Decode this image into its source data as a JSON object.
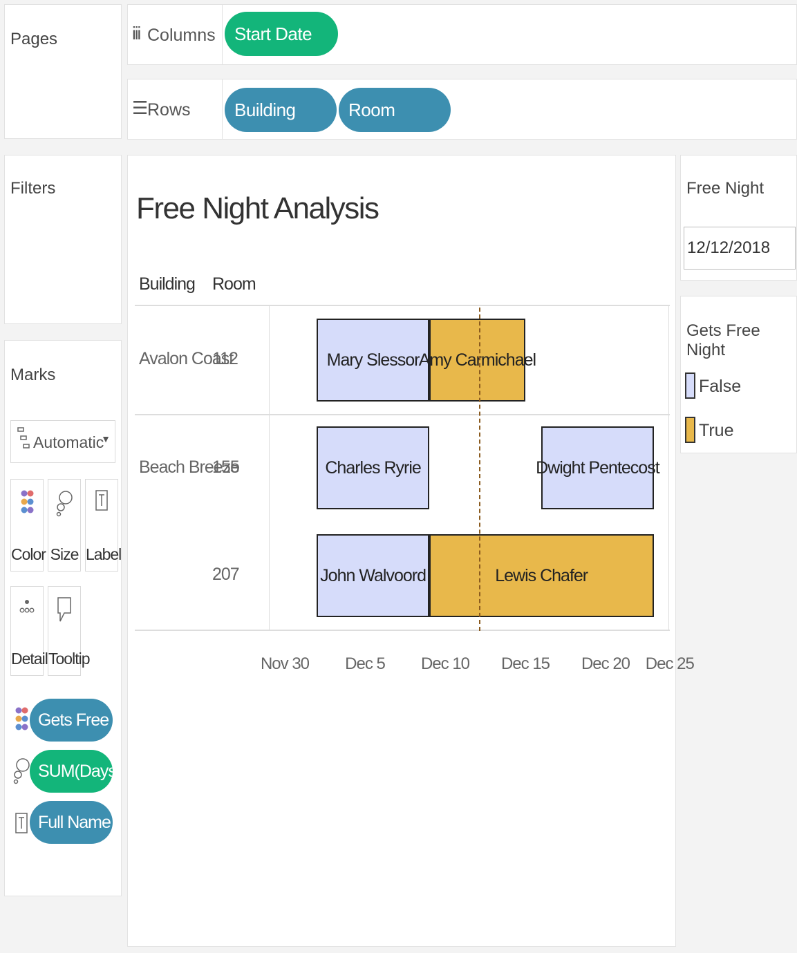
{
  "pages_shelf": {
    "title": "Pages"
  },
  "columns_shelf": {
    "icon": "iii",
    "label": "Columns",
    "pills": [
      "Start Date"
    ]
  },
  "rows_shelf": {
    "icon": "☰",
    "label": "Rows",
    "pills": [
      "Building",
      "Room"
    ]
  },
  "filters_shelf": {
    "title": "Filters"
  },
  "marks": {
    "title": "Marks",
    "mark_type": "Automatic",
    "buttons": {
      "color": "Color",
      "size": "Size",
      "label": "Label",
      "detail": "Detail",
      "tooltip": "Tooltip"
    },
    "fields": [
      {
        "label": "Gets Free Night",
        "role": "color",
        "color": "#3d8fb0"
      },
      {
        "label": "SUM(Days Re..",
        "role": "size",
        "color": "#13b57a"
      },
      {
        "label": "Full Name",
        "role": "label",
        "color": "#3d8fb0"
      }
    ]
  },
  "view": {
    "title": "Free Night Analysis",
    "headers": {
      "building": "Building",
      "room": "Room"
    }
  },
  "colors": {
    "false": "#d6dcfa",
    "true": "#e8b84b",
    "reference_line": "#8a5a1e"
  },
  "chart_data": {
    "type": "gantt",
    "title": "Free Night Analysis",
    "x_field": "Start Date",
    "row_fields": [
      "Building",
      "Room"
    ],
    "color_field": "Gets Free Night",
    "size_field": "SUM(Days Re..",
    "label_field": "Full Name",
    "x_ticks": [
      "Nov 30",
      "Dec 5",
      "Dec 10",
      "Dec 15",
      "Dec 20",
      "Dec 25"
    ],
    "reference_line": "2018-12-12",
    "rows": [
      {
        "building": "Avalon Coast",
        "room": "112",
        "bars": [
          {
            "name": "Mary Slessor",
            "start": "2018-12-02",
            "end": "2018-12-09",
            "gets_free_night": false
          },
          {
            "name": "Amy Carmichael",
            "start": "2018-12-09",
            "end": "2018-12-15",
            "gets_free_night": true
          }
        ]
      },
      {
        "building": "Beach Breeze",
        "room": "155",
        "bars": [
          {
            "name": "Charles Ryrie",
            "start": "2018-12-02",
            "end": "2018-12-09",
            "gets_free_night": false
          },
          {
            "name": "Dwight Pentecost",
            "start": "2018-12-16",
            "end": "2018-12-23",
            "gets_free_night": false
          }
        ]
      },
      {
        "building": "",
        "room": "207",
        "bars": [
          {
            "name": "John Walvoord",
            "start": "2018-12-02",
            "end": "2018-12-09",
            "gets_free_night": false
          },
          {
            "name": "Lewis Chafer",
            "start": "2018-12-09",
            "end": "2018-12-23",
            "gets_free_night": true
          }
        ]
      }
    ]
  },
  "free_night_parameter": {
    "title": "Free Night",
    "value": "12/12/2018"
  },
  "legend": {
    "title": "Gets Free Night",
    "items": [
      {
        "label": "False",
        "color": "#d6dcfa"
      },
      {
        "label": "True",
        "color": "#e8b84b"
      }
    ]
  }
}
